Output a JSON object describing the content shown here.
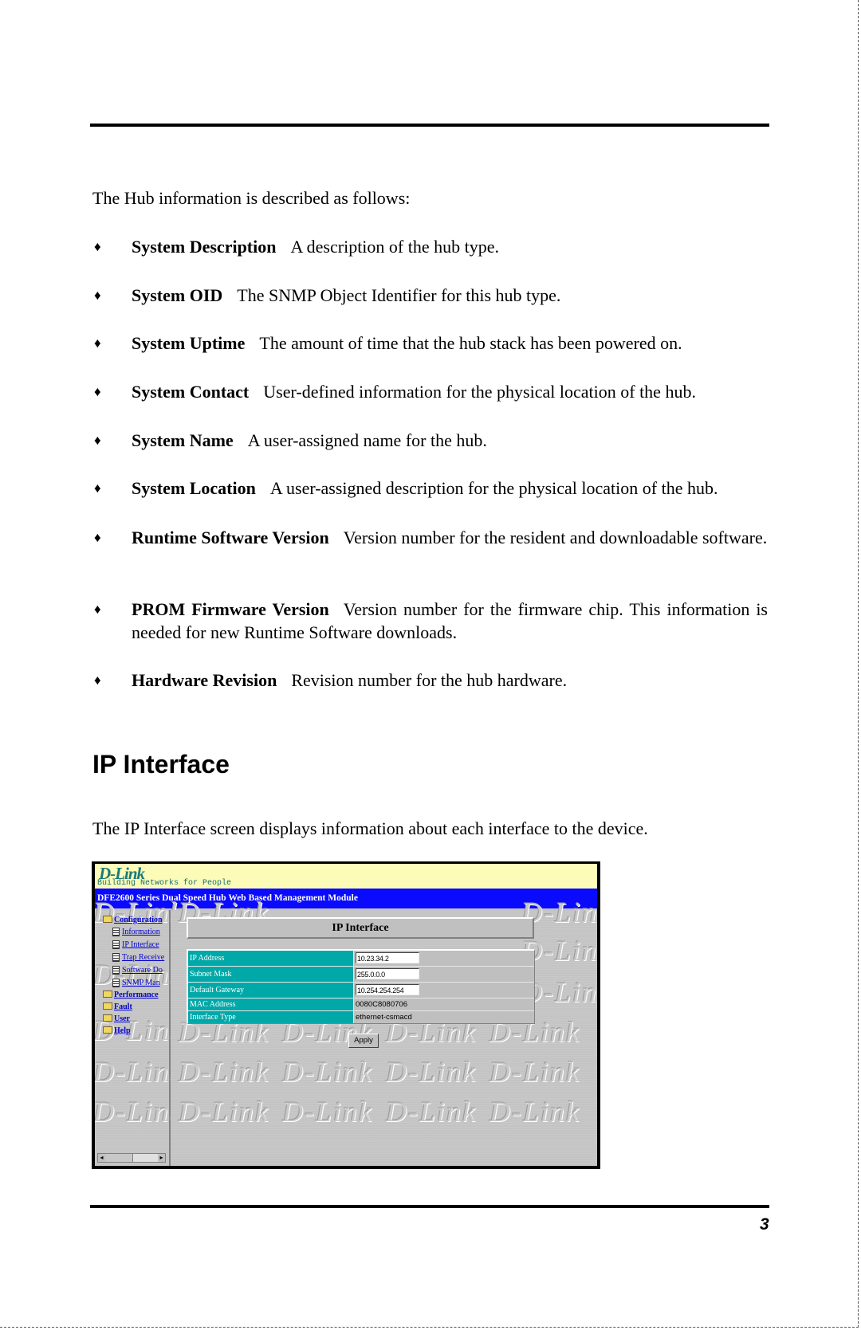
{
  "intro": "The Hub information is described as follows:",
  "bullet_glyph": "♦",
  "bullets": [
    {
      "term": "System Description",
      "desc": "A description of the hub type."
    },
    {
      "term": "System OID",
      "desc": "The SNMP Object Identifier for this hub type."
    },
    {
      "term": "System Uptime",
      "desc": "The amount of time that the hub stack has been powered on."
    },
    {
      "term": "System Contact",
      "desc": "User-defined information for the physical location of the hub."
    },
    {
      "term": "System Name",
      "desc": "A user-assigned name for the hub."
    },
    {
      "term": "System Location",
      "desc": "A user-assigned description for the physical location of the hub."
    },
    {
      "term": "Runtime Software Version",
      "desc": "Version number for the resident and downloadable software."
    },
    {
      "term": "PROM Firmware Version",
      "desc": "Version number for the firmware chip.  This information is needed for new Runtime Software downloads."
    },
    {
      "term": "Hardware Revision",
      "desc": "Revision number for the  hub hardware."
    }
  ],
  "section_heading": "IP Interface",
  "section_paragraph": "The IP Interface screen displays information about each interface to the device.",
  "page_number": "3",
  "screenshot": {
    "logo": "D-Link",
    "tagline": "Building Networks for People",
    "title_bar": "DFE2600 Series Dual Speed Hub Web Based Management Module",
    "watermark": "D-Link",
    "nav": {
      "configuration": "Configuration",
      "items": [
        "Information",
        "IP Interface",
        "Trap Receive",
        "Software Do",
        "SNMP Man"
      ],
      "performance": "Performance",
      "fault": "Fault",
      "user": "User",
      "help": "Help"
    },
    "panel_title": "IP Interface",
    "fields": {
      "ip_address": {
        "label": "IP Address",
        "value": "10.23.34.2"
      },
      "subnet_mask": {
        "label": "Subnet Mask",
        "value": "255.0.0.0"
      },
      "default_gateway": {
        "label": "Default Gateway",
        "value": "10.254.254.254"
      },
      "mac_address": {
        "label": "MAC Address",
        "value": "0080C8080706"
      },
      "interface_type": {
        "label": "Interface Type",
        "value": "ethernet-csmacd"
      }
    },
    "apply_label": "Apply"
  }
}
